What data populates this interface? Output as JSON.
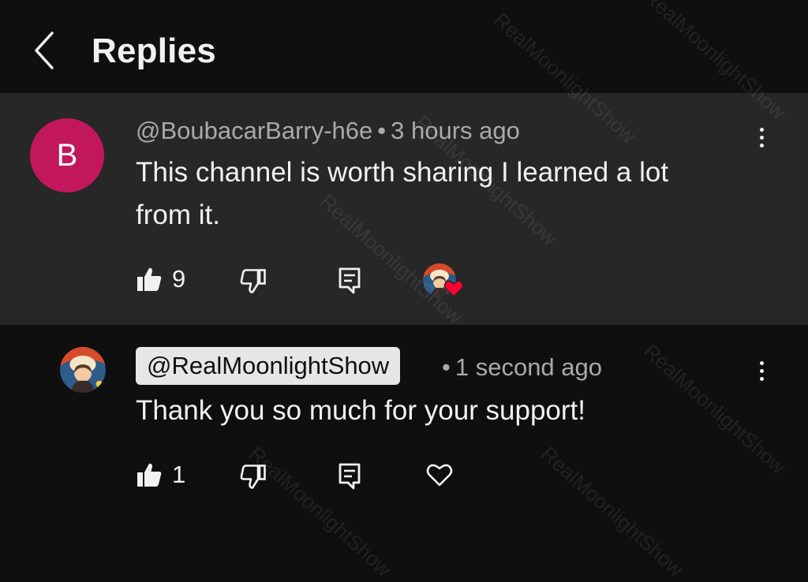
{
  "header": {
    "back_icon": "chevron-left-icon",
    "title": "Replies"
  },
  "parent_comment": {
    "avatar_letter": "B",
    "avatar_color": "#c2185b",
    "author": "@BoubacarBarry-h6e",
    "separator": "•",
    "time": "3 hours ago",
    "text_line1": "This channel is worth sharing I learned a lot",
    "text_line2": "from it.",
    "like_count": "9",
    "icons": {
      "like": "thumbs-up-icon",
      "dislike": "thumbs-down-icon",
      "reply": "reply-icon",
      "more": "more-vertical-icon",
      "creator_heart": "heart-badge-icon"
    }
  },
  "reply_comment": {
    "author": "@RealMoonlightShow",
    "separator": "•",
    "time": "1 second ago",
    "text": "Thank you so much for your support!",
    "like_count": "1",
    "icons": {
      "like": "thumbs-up-icon",
      "dislike": "thumbs-down-icon",
      "reply": "reply-icon",
      "heart": "heart-outline-icon",
      "more": "more-vertical-icon"
    }
  },
  "watermark": {
    "text": "RealMoonlightShow"
  },
  "colors": {
    "background": "#0f0f0f",
    "highlight_background": "#272727",
    "primary_text": "#f1f1f1",
    "secondary_text": "#aaaaaa",
    "heart_red": "#ff0033",
    "chip_background": "#e6e6e6"
  }
}
